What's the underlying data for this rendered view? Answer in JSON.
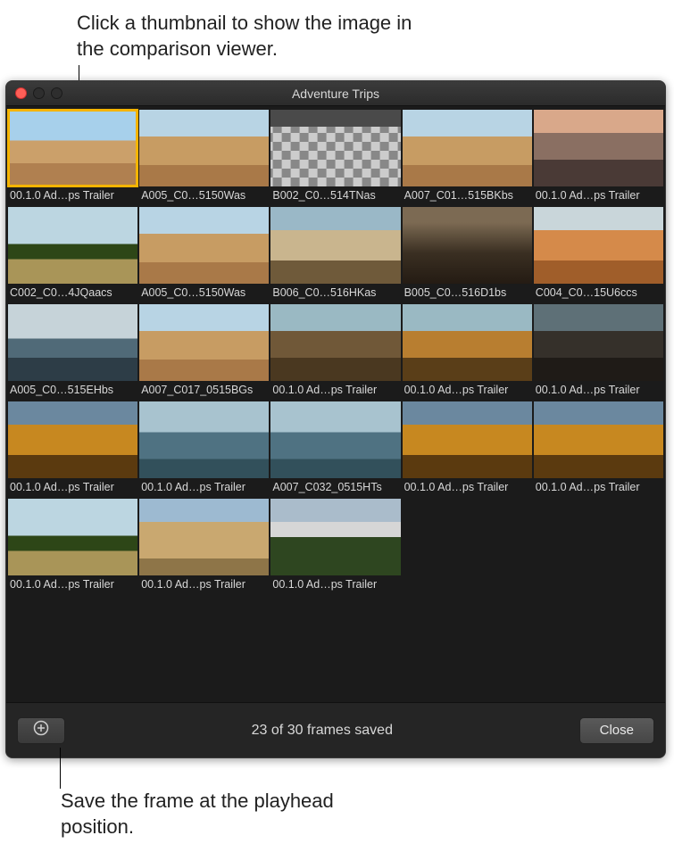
{
  "annotations": {
    "top": "Click a thumbnail to show the image in the comparison viewer.",
    "bottom": "Save the frame at the playhead position."
  },
  "window": {
    "title": "Adventure Trips",
    "status": "23 of 30 frames saved",
    "close_label": "Close"
  },
  "thumbnails": [
    {
      "label": "00.1.0 Ad…ps Trailer",
      "paint": "p-town",
      "selected": true
    },
    {
      "label": "A005_C0…5150Was",
      "paint": "p-town2"
    },
    {
      "label": "B002_C0…514TNas",
      "paint": "p-checker"
    },
    {
      "label": "A007_C01…515BKbs",
      "paint": "p-town2"
    },
    {
      "label": "00.1.0 Ad…ps Trailer",
      "paint": "p-sunset"
    },
    {
      "label": "C002_C0…4JQaacs",
      "paint": "p-trees"
    },
    {
      "label": "A005_C0…5150Was",
      "paint": "p-town2"
    },
    {
      "label": "B006_C0…516HKas",
      "paint": "p-flag"
    },
    {
      "label": "B005_C0…516D1bs",
      "paint": "p-alley"
    },
    {
      "label": "C004_C0…15U6ccs",
      "paint": "p-orange"
    },
    {
      "label": "A005_C0…515EHbs",
      "paint": "p-ship"
    },
    {
      "label": "A007_C017_0515BGs",
      "paint": "p-town2"
    },
    {
      "label": "00.1.0 Ad…ps Trailer",
      "paint": "p-cliff"
    },
    {
      "label": "00.1.0 Ad…ps Trailer",
      "paint": "p-cliff-lit"
    },
    {
      "label": "00.1.0 Ad…ps Trailer",
      "paint": "p-cliff-dk"
    },
    {
      "label": "00.1.0 Ad…ps Trailer",
      "paint": "p-golden"
    },
    {
      "label": "00.1.0 Ad…ps Trailer",
      "paint": "p-sea"
    },
    {
      "label": "A007_C032_0515HTs",
      "paint": "p-sea"
    },
    {
      "label": "00.1.0 Ad…ps Trailer",
      "paint": "p-golden"
    },
    {
      "label": "00.1.0 Ad…ps Trailer",
      "paint": "p-golden"
    },
    {
      "label": "00.1.0 Ad…ps Trailer",
      "paint": "p-trees"
    },
    {
      "label": "00.1.0 Ad…ps Trailer",
      "paint": "p-tower"
    },
    {
      "label": "00.1.0 Ad…ps Trailer",
      "paint": "p-mtn"
    }
  ]
}
